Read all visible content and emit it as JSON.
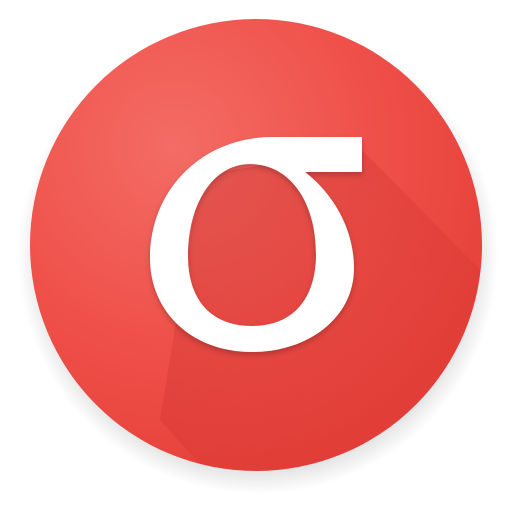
{
  "icon": {
    "semantic": "sigma-app-icon",
    "glyph": "sigma-icon",
    "colors": {
      "background": "#ffffff",
      "circle_light": "#f26a63",
      "circle_mid": "#ef4f48",
      "circle_dark": "#e53935",
      "glyph": "#ffffff",
      "long_shadow": "#c62828"
    }
  }
}
